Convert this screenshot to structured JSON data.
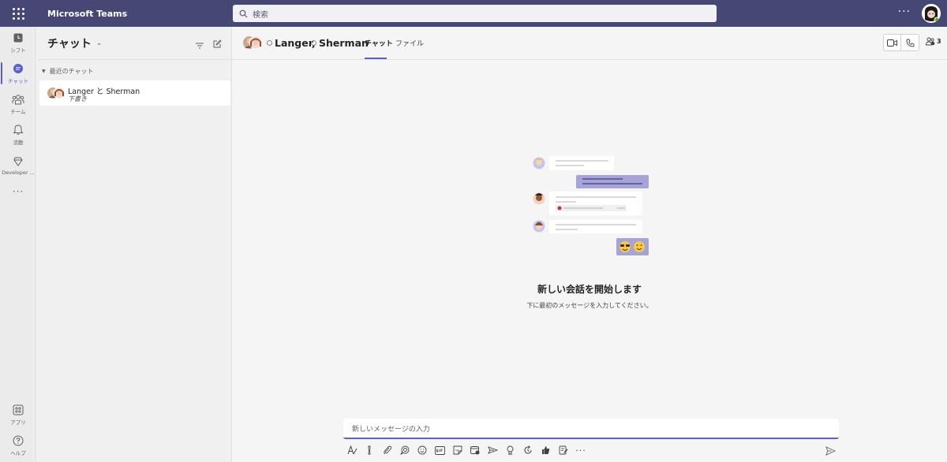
{
  "app": {
    "title": "Microsoft Teams"
  },
  "search": {
    "placeholder": "検索"
  },
  "top_more": "···",
  "rail": {
    "items": [
      {
        "label": "シフト",
        "icon": "shifts-icon"
      },
      {
        "label": "チャット",
        "icon": "chat-icon",
        "active": true
      },
      {
        "label": "チーム",
        "icon": "teams-icon"
      },
      {
        "label": "活動",
        "icon": "bell-icon"
      },
      {
        "label": "Developer ...",
        "icon": "developer-icon"
      }
    ],
    "more": "···",
    "bottom_items": [
      {
        "label": "アプリ",
        "icon": "apps-icon"
      },
      {
        "label": "ヘルプ",
        "icon": "help-icon"
      }
    ]
  },
  "chat_list": {
    "title": "チャット",
    "section": "最近のチャット",
    "items": [
      {
        "name": "Langer と Sherman",
        "preview": "下書き"
      }
    ]
  },
  "conversation": {
    "participants": [
      "Langer,",
      "Sherman"
    ],
    "tabs": [
      {
        "label": "チャット",
        "active": true
      },
      {
        "label": "ファイル",
        "active": false
      }
    ],
    "participant_count": "3",
    "empty_title": "新しい会話を開始します",
    "empty_subtitle": "下に最初のメッセージを入力してください。",
    "composer_placeholder": "新しいメッセージの入力"
  },
  "colors": {
    "brand": "#464775",
    "accent": "#5b5fc7",
    "illustration_purple": "#a6a3d6"
  }
}
